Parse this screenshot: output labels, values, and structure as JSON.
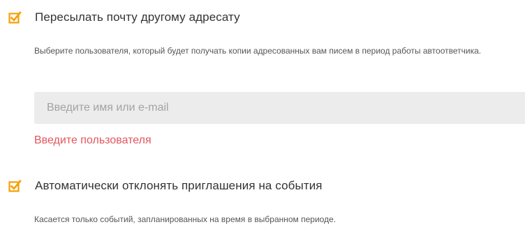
{
  "colors": {
    "checkbox_accent": "#f5a000",
    "error": "#e2575e",
    "input_bg": "#ececec",
    "title_text": "#333333",
    "hint_text": "#555555"
  },
  "forward_mail": {
    "checked": true,
    "checkbox_icon": "checkbox-checked-icon",
    "title": "Пересылать почту другому адресату",
    "hint": "Выберите пользователя, который будет получать копии адресованных вам писем в период работы автоответчика.",
    "input_placeholder": "Введите имя или e-mail",
    "input_value": "",
    "error": "Введите пользователя"
  },
  "decline_invites": {
    "checked": true,
    "checkbox_icon": "checkbox-checked-icon",
    "title": "Автоматически отклонять приглашения на события",
    "hint": "Касается только событий, запланированных на время в выбранном периоде."
  }
}
